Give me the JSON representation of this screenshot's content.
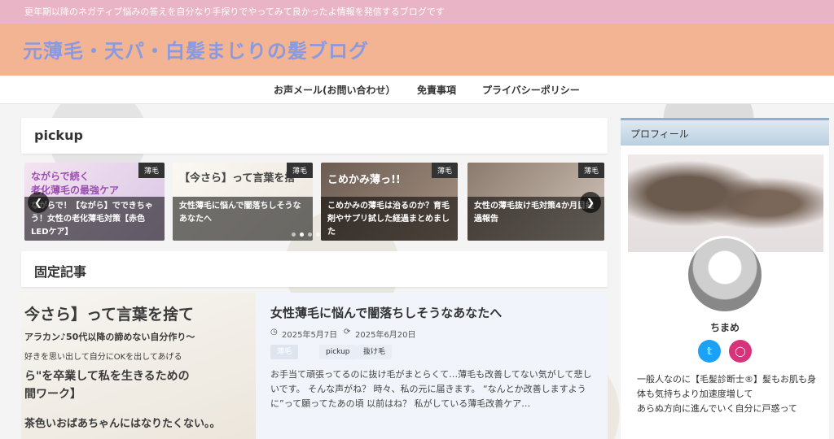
{
  "topbar": {
    "tagline": "更年期以降のネガティブ悩みの答えを自分なり手探りでやってみて良かったよ情報を発信するブログです"
  },
  "header": {
    "site_title": "元薄毛・天パ・白髪まじりの髪ブログ"
  },
  "nav": {
    "items": [
      "お声メール(お問い合わせ）",
      "免責事項",
      "プライバシーポリシー"
    ]
  },
  "pickup": {
    "title": "pickup",
    "slides": [
      {
        "tag": "薄毛",
        "overlay": "ながらで続く\n老化薄毛の最強ケア",
        "caption": "ながらで！【ながら】でできちゃう！女性の老化薄毛対策【赤色LEDケア】"
      },
      {
        "tag": "薄毛",
        "overlay": "【今さら】って言葉を捨",
        "caption": "女性薄毛に悩んで闇落ちしそうなあなたへ"
      },
      {
        "tag": "薄毛",
        "overlay": "こめかみ薄っ!!",
        "caption": "こめかみの薄毛は治るのか？育毛剤やサプリ試した経過まとめました"
      },
      {
        "tag": "薄毛",
        "overlay": "",
        "caption": "女性の薄毛抜け毛対策4か月目経過報告"
      }
    ],
    "prev_icon": "chevron-left-icon",
    "next_icon": "chevron-right-icon"
  },
  "fixed": {
    "title": "固定記事",
    "article": {
      "image_lines": [
        "今さら】って言葉を捨て",
        "アラカン♪50代以降の諦めない自分作り～",
        "好きを思い出して自分にOKを出してあげる",
        "ら\"を卒業して私を生きるための",
        "間ワーク】",
        "茶色いおばあちゃんにはなりたくない。。"
      ],
      "title": "女性薄毛に悩んで闇落ちしそうなあなたへ",
      "published": "2025年5月7日",
      "updated": "2025年6月20日",
      "category": "薄毛",
      "tags": [
        "pickup",
        "抜け毛"
      ],
      "excerpt": "お手当て頑張ってるのに抜け毛がまとらくて…薄毛も改善してない気がして悲しいです。 そんな声がね？ 時々、私の元に届きます。 “なんとか改善しますように”って願ってたあの頃 以前はね？ 私がしている薄毛改善ケア…"
    }
  },
  "sidebar": {
    "heading": "プロフィール",
    "name": "ちまめ",
    "social": [
      "twitter-icon",
      "instagram-icon"
    ],
    "profile_text": "一般人なのに【毛髪診断士®】髪もお肌も身体も気持ちより加速度増して\nあらぬ方向に進んでいく自分に戸惑って"
  },
  "colors": {
    "topbar": "#e8b4c6",
    "header": "#f3b493",
    "title": "#8a9ae0",
    "twitter": "#1da1f2",
    "instagram": "#d6337a"
  }
}
